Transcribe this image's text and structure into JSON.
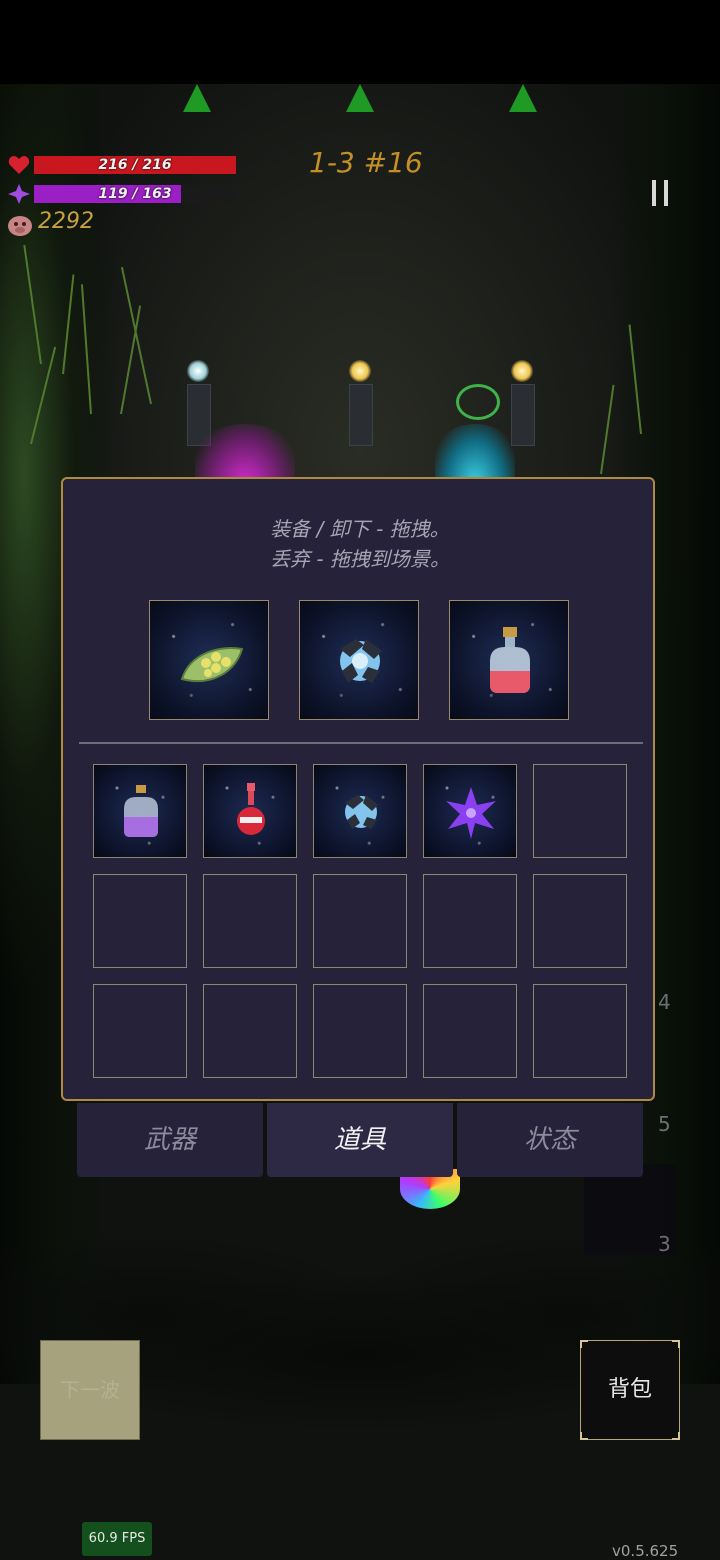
{
  "hud": {
    "hp_text": "216 / 216",
    "hp_fraction": 1.0,
    "mp_text": "119 / 163",
    "mp_fraction": 0.73,
    "coins": "2292",
    "level": "1-3 #16",
    "pause_label": "II"
  },
  "panel": {
    "hint_line1": "装备 / 卸下 - 拖拽。",
    "hint_line2": "丢弃 - 拖拽到场景。",
    "equipped": [
      "leaf-seed-icon",
      "crystal-orb-icon",
      "red-potion-flask-icon"
    ],
    "inventory": [
      "purple-potion-icon",
      "red-potion-bottle-icon",
      "crystal-orb-icon",
      "purple-shuriken-icon",
      "",
      "",
      "",
      "",
      "",
      "",
      "",
      "",
      "",
      "",
      ""
    ]
  },
  "tabs": [
    "武器",
    "道具",
    "状态"
  ],
  "buttons": {
    "next_wave": "下一波",
    "bag": "背包"
  },
  "side_numbers": [
    "4",
    "5",
    "3"
  ],
  "fps": "60.9 FPS",
  "version": "v0.5.625",
  "colors": {
    "hp": "#c8171f",
    "mp": "#9a1fc4",
    "panel_border": "#b08a3e",
    "panel_bg": "#26223a",
    "level_text": "#c58f28"
  }
}
